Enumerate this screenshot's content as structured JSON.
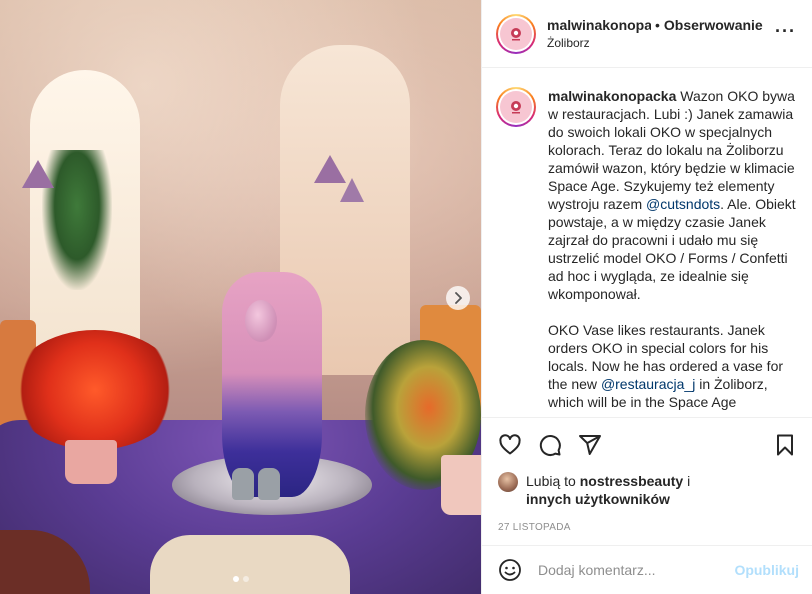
{
  "post": {
    "username": "malwinakonopacka",
    "separator": "•",
    "follow_label": "Obserwowanie",
    "location": "Żoliborz",
    "more_icon": "more-options-icon"
  },
  "caption": {
    "username": "malwinakonopacka",
    "pl_part1": " Wazon OKO bywa w restauracjach. Lubi :) Janek zamawia do swoich lokali OKO w specjalnych kolorach. Teraz do lokalu na Żoliborzu zamówił wazon, który będzie w klimacie Space Age. Szykujemy też elementy wystroju razem ",
    "pl_mention": "@cutsndots",
    "pl_part2": ". Ale. Obiekt powstaje, a w między czasie Janek zajrzał do pracowni i udało mu się ustrzelić model OKO / Forms / Confetti ad hoc i wygląda, ze idealnie się wkomponował.",
    "en_part1": "OKO Vase likes restaurants. Janek orders OKO in special colors for his locals. Now he has ordered a vase for the new ",
    "en_mention": "@restauracja_j",
    "en_part2": " in Żoliborz, which will be in the Space Age"
  },
  "likes": {
    "prefix": "Lubią to ",
    "user": "nostressbeauty",
    "mid": " i",
    "others": "innych użytkowników"
  },
  "date": "27 LISTOPADA",
  "comment": {
    "placeholder": "Dodaj komentarz...",
    "post_label": "Opublikuj"
  },
  "carousel": {
    "slide_count": 2,
    "active_slide": 1
  },
  "colors": {
    "link": "#00376b",
    "post_disabled": "#b2dffc",
    "muted": "#8e8e8e"
  }
}
